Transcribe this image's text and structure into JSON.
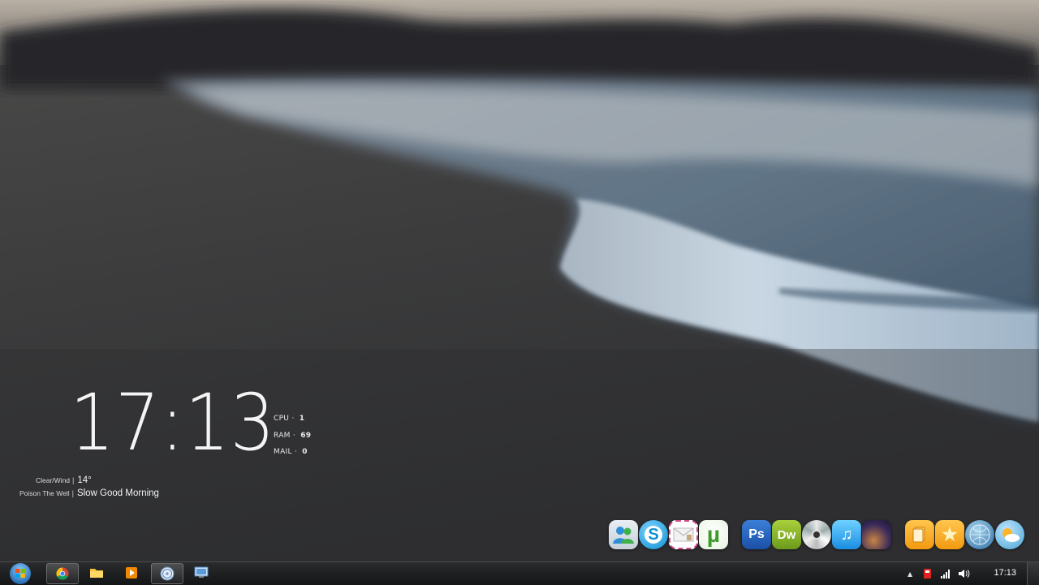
{
  "clock": {
    "time": "17:13"
  },
  "stats": [
    {
      "label": "CPU",
      "value": "1"
    },
    {
      "label": "RAM",
      "value": "69"
    },
    {
      "label": "MAIL",
      "value": "0"
    }
  ],
  "weather": {
    "condition": "Clear/Wind",
    "temperature": "14°"
  },
  "music": {
    "artist": "Poison The Well",
    "track": "Slow Good Morning"
  },
  "separator": "|",
  "dock_icons": [
    {
      "name": "contacts-icon"
    },
    {
      "name": "skype-icon",
      "glyph": "S"
    },
    {
      "name": "mail-icon"
    },
    {
      "name": "utorrent-icon",
      "glyph": "µ"
    },
    {
      "name": "photoshop-icon",
      "glyph": "Ps"
    },
    {
      "name": "dreamweaver-icon",
      "glyph": "Dw"
    },
    {
      "name": "dvd-icon"
    },
    {
      "name": "itunes-icon",
      "glyph": "♫"
    },
    {
      "name": "space-icon"
    },
    {
      "name": "documents-icon"
    },
    {
      "name": "favorites-icon",
      "glyph": "★"
    },
    {
      "name": "network-icon"
    },
    {
      "name": "weather-icon"
    }
  ],
  "taskbar": {
    "start": "start-orb-icon",
    "pinned": [
      {
        "name": "chrome-icon",
        "active": true
      },
      {
        "name": "explorer-folder-icon"
      },
      {
        "name": "media-player-icon"
      },
      {
        "name": "itunes-taskbar-icon",
        "active": true
      },
      {
        "name": "remote-desktop-icon"
      }
    ],
    "tray_time": "17:13"
  },
  "colors": {
    "taskbar": "#1e1f21",
    "text": "#f4f4f4",
    "foam": "#c8d6e2"
  }
}
